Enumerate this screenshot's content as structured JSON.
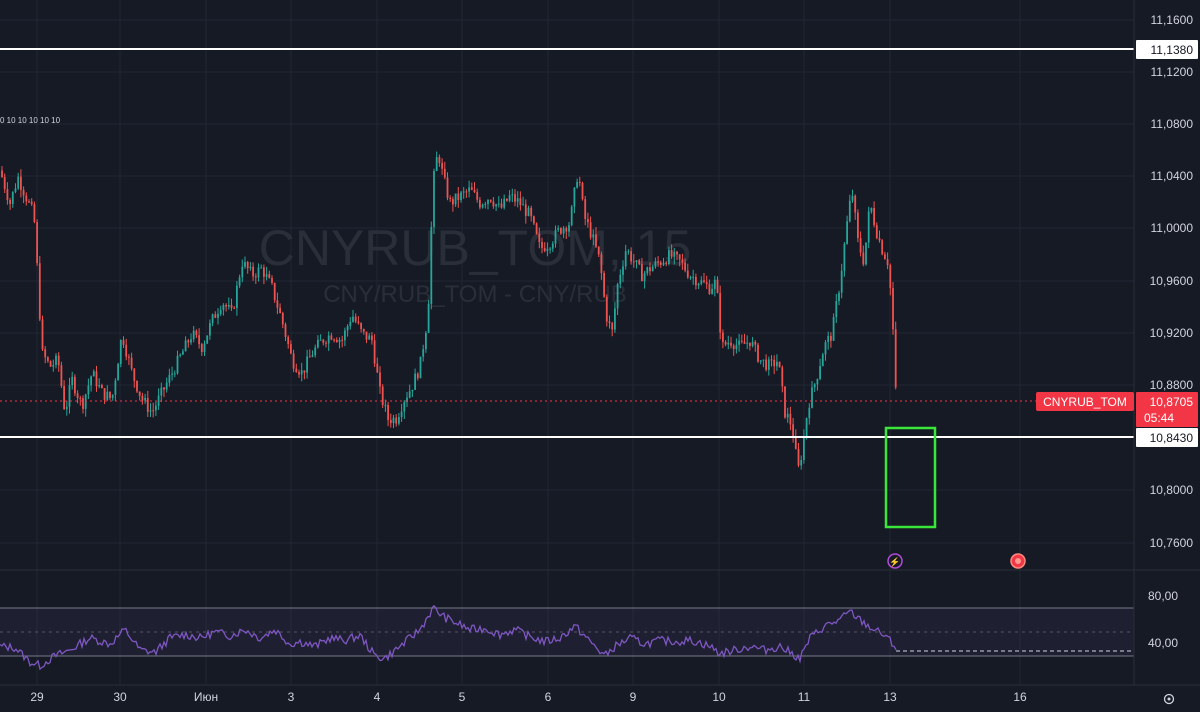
{
  "watermark": {
    "symbol": "CNYRUB_TOM, 15",
    "description": "CNY/RUB_TOM - CNY/RUB"
  },
  "header": {
    "tick_marks_text": "0 10 10 10 10 10"
  },
  "price_axis": {
    "labels": [
      "11,1600",
      "11,1200",
      "11,0800",
      "11,0400",
      "11,0000",
      "10,9600",
      "10,9200",
      "10,8800",
      "10,8000",
      "10,7600"
    ]
  },
  "rsi_axis": {
    "labels": [
      "80,00",
      "40,00"
    ]
  },
  "time_axis": {
    "labels": [
      "29",
      "30",
      "Июн",
      "3",
      "4",
      "5",
      "6",
      "9",
      "10",
      "11",
      "13",
      "16"
    ]
  },
  "levels": {
    "resistance": "11,1380",
    "support": "10,8430"
  },
  "current_price": {
    "symbol": "CNYRUB_TOM",
    "price": "10,8705",
    "countdown": "05:44"
  },
  "colors": {
    "background": "#161a25",
    "up": "#26a69a",
    "down": "#ef5350",
    "level_line": "#ffffff",
    "target_box": "#39e639",
    "rsi_line": "#7e57c2",
    "price_badge": "#f23645"
  },
  "chart_data": {
    "type": "candlestick",
    "symbol": "CNYRUB_TOM",
    "interval": "15",
    "y_range": [
      10.74,
      11.17
    ],
    "horizontal_levels": [
      11.138,
      10.843
    ],
    "last_price": 10.8705,
    "target_zone": {
      "top": 10.845,
      "bottom": 10.776
    },
    "close_path": [
      [
        0,
        11.045
      ],
      [
        10,
        11.02
      ],
      [
        18,
        11.04
      ],
      [
        26,
        11.025
      ],
      [
        34,
        11.01
      ],
      [
        38,
        10.96
      ],
      [
        42,
        10.905
      ],
      [
        50,
        10.895
      ],
      [
        58,
        10.9
      ],
      [
        65,
        10.86
      ],
      [
        72,
        10.885
      ],
      [
        82,
        10.865
      ],
      [
        92,
        10.89
      ],
      [
        102,
        10.875
      ],
      [
        112,
        10.87
      ],
      [
        122,
        10.92
      ],
      [
        132,
        10.89
      ],
      [
        142,
        10.87
      ],
      [
        152,
        10.86
      ],
      [
        162,
        10.875
      ],
      [
        172,
        10.89
      ],
      [
        182,
        10.905
      ],
      [
        192,
        10.92
      ],
      [
        202,
        10.91
      ],
      [
        212,
        10.93
      ],
      [
        222,
        10.945
      ],
      [
        232,
        10.935
      ],
      [
        242,
        10.975
      ],
      [
        252,
        10.965
      ],
      [
        262,
        10.97
      ],
      [
        272,
        10.955
      ],
      [
        282,
        10.93
      ],
      [
        292,
        10.9
      ],
      [
        302,
        10.89
      ],
      [
        312,
        10.905
      ],
      [
        322,
        10.915
      ],
      [
        332,
        10.92
      ],
      [
        342,
        10.915
      ],
      [
        352,
        10.935
      ],
      [
        362,
        10.92
      ],
      [
        372,
        10.915
      ],
      [
        380,
        10.875
      ],
      [
        388,
        10.855
      ],
      [
        396,
        10.855
      ],
      [
        404,
        10.87
      ],
      [
        412,
        10.88
      ],
      [
        420,
        10.895
      ],
      [
        428,
        10.935
      ],
      [
        433,
        11.035
      ],
      [
        438,
        11.06
      ],
      [
        443,
        11.04
      ],
      [
        450,
        11.02
      ],
      [
        460,
        11.025
      ],
      [
        470,
        11.03
      ],
      [
        480,
        11.02
      ],
      [
        490,
        11.025
      ],
      [
        500,
        11.015
      ],
      [
        510,
        11.025
      ],
      [
        520,
        11.02
      ],
      [
        530,
        11.01
      ],
      [
        540,
        10.985
      ],
      [
        550,
        10.99
      ],
      [
        560,
        11.0
      ],
      [
        570,
        11.005
      ],
      [
        578,
        11.045
      ],
      [
        584,
        11.01
      ],
      [
        592,
        10.995
      ],
      [
        600,
        10.975
      ],
      [
        606,
        10.935
      ],
      [
        612,
        10.92
      ],
      [
        618,
        10.96
      ],
      [
        626,
        10.985
      ],
      [
        634,
        10.975
      ],
      [
        642,
        10.965
      ],
      [
        650,
        10.97
      ],
      [
        660,
        10.975
      ],
      [
        670,
        10.98
      ],
      [
        680,
        10.975
      ],
      [
        690,
        10.965
      ],
      [
        700,
        10.96
      ],
      [
        710,
        10.955
      ],
      [
        716,
        10.96
      ],
      [
        722,
        10.91
      ],
      [
        730,
        10.915
      ],
      [
        740,
        10.91
      ],
      [
        750,
        10.915
      ],
      [
        760,
        10.9
      ],
      [
        770,
        10.895
      ],
      [
        778,
        10.9
      ],
      [
        785,
        10.86
      ],
      [
        792,
        10.85
      ],
      [
        798,
        10.815
      ],
      [
        802,
        10.83
      ],
      [
        808,
        10.865
      ],
      [
        816,
        10.885
      ],
      [
        824,
        10.91
      ],
      [
        832,
        10.92
      ],
      [
        840,
        10.96
      ],
      [
        848,
        11.01
      ],
      [
        852,
        11.03
      ],
      [
        858,
        10.99
      ],
      [
        864,
        10.975
      ],
      [
        870,
        11.02
      ],
      [
        876,
        11.0
      ],
      [
        882,
        10.985
      ],
      [
        888,
        10.975
      ],
      [
        892,
        10.94
      ],
      [
        896,
        10.8705
      ]
    ],
    "rsi": {
      "y_range": [
        0,
        100
      ],
      "bands": [
        70,
        30
      ],
      "midline": 50,
      "values": [
        [
          0,
          38
        ],
        [
          15,
          37
        ],
        [
          30,
          25
        ],
        [
          40,
          22
        ],
        [
          55,
          30
        ],
        [
          70,
          35
        ],
        [
          90,
          45
        ],
        [
          110,
          40
        ],
        [
          125,
          52
        ],
        [
          140,
          35
        ],
        [
          155,
          33
        ],
        [
          170,
          45
        ],
        [
          185,
          48
        ],
        [
          200,
          45
        ],
        [
          215,
          50
        ],
        [
          230,
          47
        ],
        [
          245,
          52
        ],
        [
          260,
          45
        ],
        [
          275,
          52
        ],
        [
          290,
          40
        ],
        [
          300,
          42
        ],
        [
          315,
          38
        ],
        [
          330,
          45
        ],
        [
          345,
          43
        ],
        [
          360,
          47
        ],
        [
          375,
          30
        ],
        [
          385,
          28
        ],
        [
          400,
          38
        ],
        [
          420,
          52
        ],
        [
          433,
          70
        ],
        [
          445,
          62
        ],
        [
          455,
          58
        ],
        [
          470,
          52
        ],
        [
          485,
          53
        ],
        [
          500,
          48
        ],
        [
          515,
          52
        ],
        [
          530,
          46
        ],
        [
          545,
          42
        ],
        [
          560,
          45
        ],
        [
          575,
          55
        ],
        [
          590,
          42
        ],
        [
          605,
          30
        ],
        [
          615,
          38
        ],
        [
          630,
          45
        ],
        [
          645,
          40
        ],
        [
          660,
          43
        ],
        [
          675,
          42
        ],
        [
          690,
          43
        ],
        [
          700,
          41
        ],
        [
          710,
          38
        ],
        [
          720,
          32
        ],
        [
          735,
          35
        ],
        [
          750,
          38
        ],
        [
          765,
          35
        ],
        [
          780,
          38
        ],
        [
          790,
          33
        ],
        [
          800,
          28
        ],
        [
          810,
          45
        ],
        [
          825,
          55
        ],
        [
          840,
          60
        ],
        [
          850,
          67
        ],
        [
          860,
          60
        ],
        [
          870,
          54
        ],
        [
          885,
          47
        ],
        [
          896,
          37
        ]
      ]
    }
  }
}
